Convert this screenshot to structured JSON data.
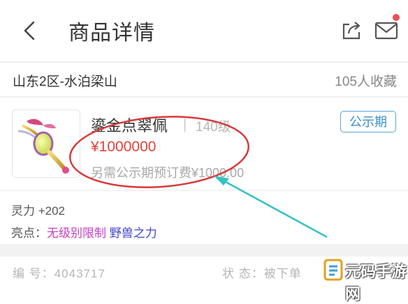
{
  "header": {
    "title": "商品详情",
    "back_icon": "back-arrow-icon",
    "share_icon": "share-icon",
    "mail_icon": "mail-icon"
  },
  "listing": {
    "server": "山东2区-水泊梁山",
    "favorites": "105人收藏"
  },
  "item": {
    "name": "鎏金点翠佩",
    "separator": "|",
    "level": "140级",
    "badge": "公示期",
    "price": "¥1000000",
    "fee": "另需公示期预订费¥1000.00"
  },
  "attributes": {
    "spirit": "灵力 +202",
    "highlights_label": "亮点：",
    "highlight_1": "无级别限制",
    "highlight_2": "野兽之力"
  },
  "meta": {
    "serial": "编  号：4043717",
    "status": "状  态：被下单"
  },
  "watermark": {
    "text": "元码手游网"
  },
  "colors": {
    "price": "#e2433b",
    "badge": "#3a8fd0",
    "highlight_1": "#c63fc2",
    "highlight_2": "#3f45c9",
    "annotation_circle": "#d63a3a",
    "annotation_arrow": "#33c1c4"
  }
}
